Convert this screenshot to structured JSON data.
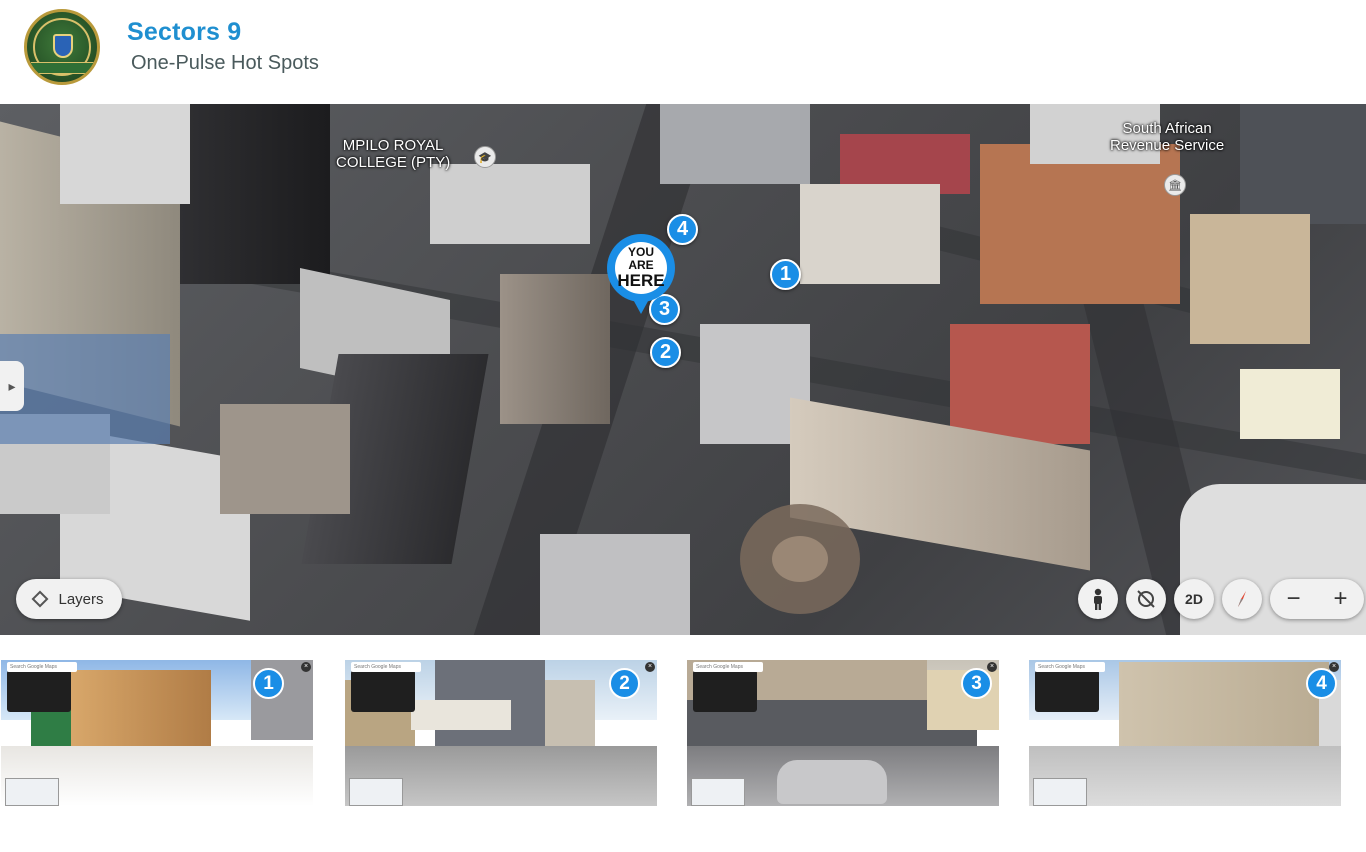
{
  "header": {
    "title": "Sectors 9",
    "subtitle": "One-Pulse Hot Spots"
  },
  "map": {
    "labels": {
      "college": "MPILO ROYAL\nCOLLEGE (PTY)",
      "sars": "South African\nRevenue Service"
    },
    "you_are_here": {
      "line1": "YOU ARE",
      "line2": "HERE"
    },
    "hotspots": [
      "1",
      "2",
      "3",
      "4"
    ],
    "layers_label": "Layers",
    "controls": {
      "pegman_icon": "person-icon",
      "tilt_icon": "tilt-icon",
      "view_mode": "2D",
      "compass_icon": "compass-icon",
      "zoom_out": "−",
      "zoom_in": "+"
    }
  },
  "thumbnails": [
    {
      "number": "1",
      "search_placeholder": "Search Google Maps"
    },
    {
      "number": "2",
      "search_placeholder": "Search Google Maps"
    },
    {
      "number": "3",
      "search_placeholder": "Search Google Maps"
    },
    {
      "number": "4",
      "search_placeholder": "Search Google Maps"
    }
  ]
}
